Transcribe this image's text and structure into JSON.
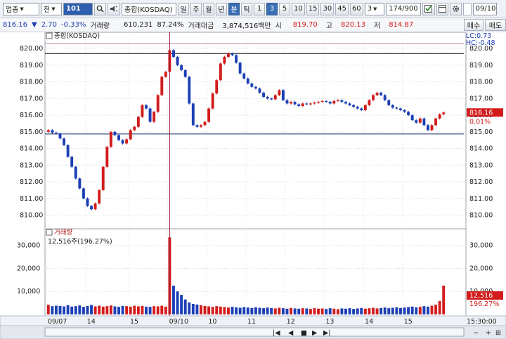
{
  "toolbar": {
    "market_select": "업종",
    "period_select": "전",
    "code": "101",
    "index_name": "종합(KOSDAQ)",
    "period_buttons": [
      "일",
      "주",
      "월",
      "년",
      "분",
      "틱"
    ],
    "interval_buttons": [
      "1",
      "3",
      "5",
      "10",
      "15",
      "30",
      "45",
      "60"
    ],
    "active_period": "분",
    "active_interval": "3",
    "interval_value": "3",
    "count": "174/900",
    "date": "09/10"
  },
  "quote": {
    "price": "816.16",
    "change": "2.70",
    "change_pct": "-0.33%",
    "volume_label": "거래량",
    "volume": "610,231",
    "volume_ratio": "87.24%",
    "amount_label": "거래대금",
    "amount": "3,874,516백만",
    "open_label": "시",
    "open": "819.70",
    "high_label": "고",
    "high": "820.13",
    "low_label": "저",
    "low": "814.87",
    "buy_button": "매수",
    "sell_button": "매도"
  },
  "price_panel": {
    "title": "종합(KOSDAQ)",
    "lc_label": "LC:0.73",
    "hc_label": "HC:-0.48",
    "current_price_label": "816.16",
    "current_change_label": "0.01%",
    "y_ticks": [
      "820.00",
      "819.00",
      "818.00",
      "817.00",
      "816.00",
      "815.00",
      "814.00",
      "813.00",
      "812.00",
      "811.00",
      "810.00"
    ]
  },
  "volume_panel": {
    "title": "거래량",
    "current_volume_text": "12,516주(196.27%)",
    "current_volume_label": "12,516",
    "current_ratio_label": "196.27%",
    "y_ticks": [
      "30,000",
      "20,000",
      "10,000"
    ]
  },
  "x_axis": {
    "labels": [
      "09/07",
      "14",
      "15",
      "09/10",
      "10",
      "11",
      "12",
      "13",
      "14",
      "15"
    ],
    "end_time": "15:30:00"
  },
  "colors": {
    "up": "#d31c1c",
    "down": "#1b3fb5",
    "marker": "#a21c3a",
    "bg_panel": "#ffffff",
    "header": "#eef1f5"
  },
  "chart_data": {
    "type": "candlestick",
    "ylim": [
      809.6,
      820.3
    ],
    "volume_ylim": [
      0,
      36000
    ],
    "reference_lines": [
      819.7,
      814.87
    ],
    "close_series": [
      815.1,
      814.95,
      814.9,
      814.6,
      814.2,
      813.5,
      812.9,
      812.2,
      811.6,
      811.0,
      810.55,
      810.35,
      810.7,
      811.5,
      812.9,
      814.1,
      815.0,
      814.8,
      814.5,
      814.3,
      814.55,
      815.1,
      815.3,
      815.9,
      816.6,
      816.4,
      815.6,
      816.2,
      817.2,
      818.3,
      818.6,
      819.9,
      819.5,
      819.0,
      818.7,
      818.3,
      816.7,
      815.4,
      815.3,
      815.4,
      815.6,
      816.4,
      817.3,
      818.1,
      819.1,
      819.5,
      819.7,
      819.6,
      819.15,
      818.5,
      818.2,
      817.9,
      817.7,
      817.6,
      817.35,
      817.1,
      817.0,
      816.95,
      817.2,
      817.5,
      816.9,
      816.7,
      816.8,
      816.65,
      816.55,
      816.7,
      816.65,
      816.7,
      816.75,
      816.8,
      816.85,
      816.8,
      816.7,
      816.85,
      816.9,
      816.8,
      816.7,
      816.6,
      816.5,
      816.4,
      816.3,
      816.6,
      816.9,
      817.2,
      817.35,
      817.2,
      816.9,
      816.6,
      816.45,
      816.4,
      816.3,
      816.2,
      816.0,
      815.7,
      815.55,
      815.8,
      815.4,
      815.1,
      815.4,
      815.8,
      816.05,
      816.16
    ],
    "volume_series": [
      4200,
      3600,
      3800,
      3700,
      3500,
      4000,
      3400,
      3600,
      3900,
      3300,
      3700,
      4100,
      3500,
      3800,
      3400,
      3600,
      3900,
      3500,
      3300,
      3700,
      3600,
      3400,
      3800,
      3500,
      3700,
      3400,
      3300,
      3600,
      3500,
      3800,
      3400,
      33500,
      12500,
      10000,
      8500,
      6500,
      5200,
      4600,
      4300,
      4000,
      3700,
      3500,
      3300,
      3600,
      3400,
      3200,
      3000,
      3300,
      3100,
      2900,
      3200,
      3000,
      2800,
      3100,
      2900,
      2700,
      3000,
      2800,
      2600,
      2900,
      2700,
      2500,
      2800,
      2600,
      2500,
      2700,
      2600,
      2400,
      2700,
      2500,
      2600,
      2400,
      2700,
      2500,
      2300,
      2600,
      2500,
      2700,
      2400,
      2600,
      2800,
      2500,
      2700,
      2900,
      2600,
      2800,
      3000,
      2700,
      2900,
      3100,
      2800,
      3000,
      3200,
      3400,
      3100,
      3300,
      3600,
      3400,
      3800,
      4200,
      5800,
      12516
    ]
  }
}
